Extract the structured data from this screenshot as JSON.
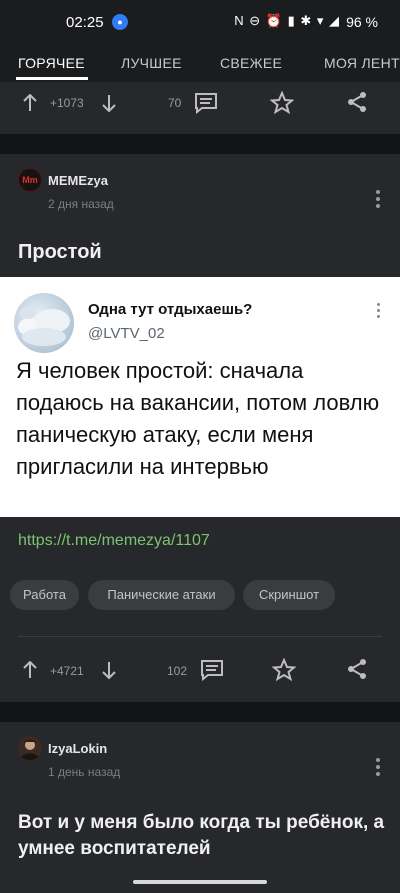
{
  "status_bar": {
    "time": "02:25",
    "system_icons": "N ⊖ ⏰ ▮ ✱ ▾ ◢",
    "battery": "96 %"
  },
  "tabs": [
    {
      "label": "ГОРЯЧЕЕ"
    },
    {
      "label": "ЛУЧШЕЕ"
    },
    {
      "label": "СВЕЖЕЕ"
    },
    {
      "label": "МОЯ ЛЕНТ"
    }
  ],
  "prev_post": {
    "rating": "+1073",
    "comments": "70"
  },
  "post1": {
    "author": "MEMEzya",
    "time": "2 дня назад",
    "avatar_text": "Mm",
    "title": "Простой",
    "tweet": {
      "name": "Одна тут отдыхаешь?",
      "handle": "@LVTV_02",
      "text": "Я человек простой: сначала подаюсь на вакансии, потом ловлю паническую атаку, если меня пригласили на интервью"
    },
    "link": "https://t.me/memezya/1107",
    "tags": [
      "Работа",
      "Панические атаки",
      "Скриншот"
    ],
    "rating": "+4721",
    "comments": "102"
  },
  "post2": {
    "author": "IzyaLokin",
    "time": "1 день назад",
    "title": "Вот и у меня было когда ты ребёнок, а умнее воспитателей"
  },
  "colors": {
    "background": "#1b1c1e",
    "card": "#26282b",
    "link": "#7cc46f",
    "tag_bg": "#3a3c40"
  }
}
